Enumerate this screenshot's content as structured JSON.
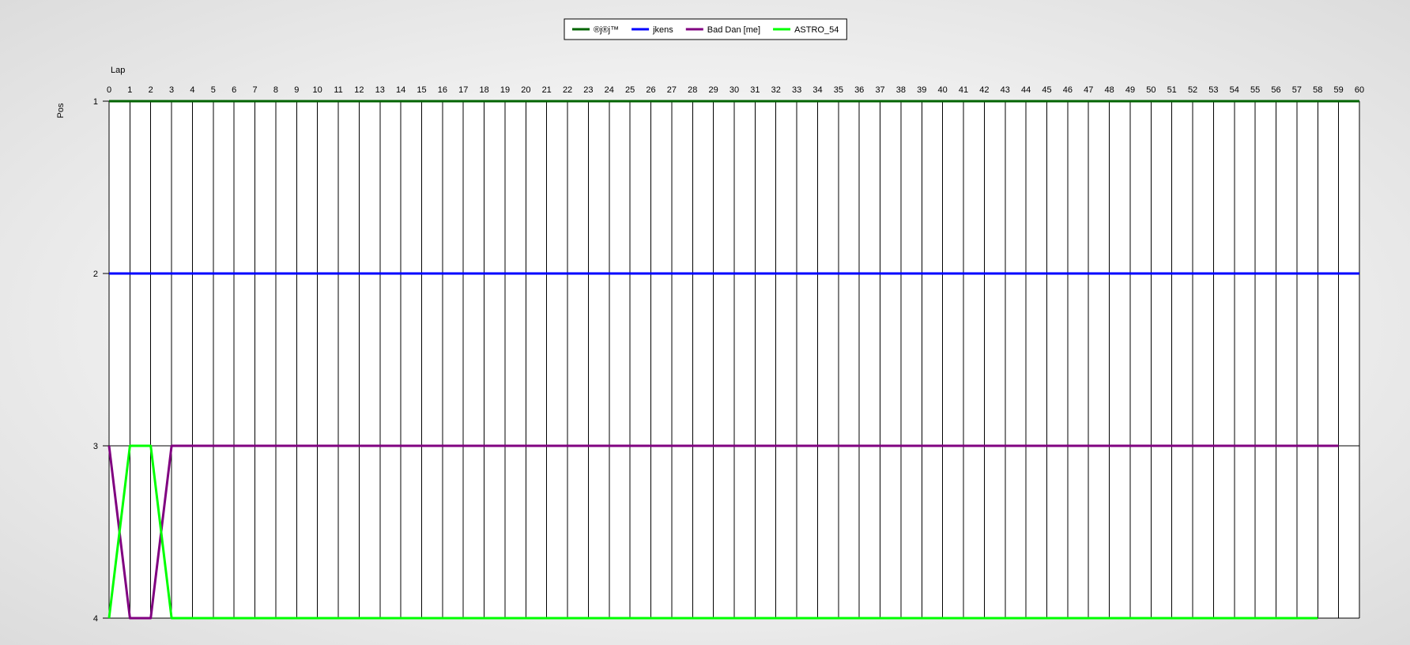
{
  "chart_data": {
    "type": "line",
    "xlabel": "Lap",
    "ylabel": "Pos",
    "xlim": [
      0,
      60
    ],
    "ylim": [
      1,
      4
    ],
    "y_inverted": true,
    "x_ticks": [
      0,
      1,
      2,
      3,
      4,
      5,
      6,
      7,
      8,
      9,
      10,
      11,
      12,
      13,
      14,
      15,
      16,
      17,
      18,
      19,
      20,
      21,
      22,
      23,
      24,
      25,
      26,
      27,
      28,
      29,
      30,
      31,
      32,
      33,
      34,
      35,
      36,
      37,
      38,
      39,
      40,
      41,
      42,
      43,
      44,
      45,
      46,
      47,
      48,
      49,
      50,
      51,
      52,
      53,
      54,
      55,
      56,
      57,
      58,
      59,
      60
    ],
    "y_ticks": [
      1,
      2,
      3,
      4
    ],
    "x_axis_position": "top",
    "grid": true,
    "legend_position": "top-center",
    "series": [
      {
        "name": "®j®j™",
        "color": "#006400",
        "points": [
          [
            0,
            1
          ],
          [
            60,
            1
          ]
        ]
      },
      {
        "name": "jkens",
        "color": "#0000ff",
        "points": [
          [
            0,
            2
          ],
          [
            60,
            2
          ]
        ]
      },
      {
        "name": "Bad Dan [me]",
        "color": "#800080",
        "points": [
          [
            0,
            3
          ],
          [
            1,
            4
          ],
          [
            2,
            4
          ],
          [
            3,
            3
          ],
          [
            59,
            3
          ]
        ]
      },
      {
        "name": "ASTRO_54",
        "color": "#00ff00",
        "points": [
          [
            0,
            4
          ],
          [
            1,
            3
          ],
          [
            2,
            3
          ],
          [
            3,
            4
          ],
          [
            58,
            4
          ]
        ]
      }
    ]
  }
}
